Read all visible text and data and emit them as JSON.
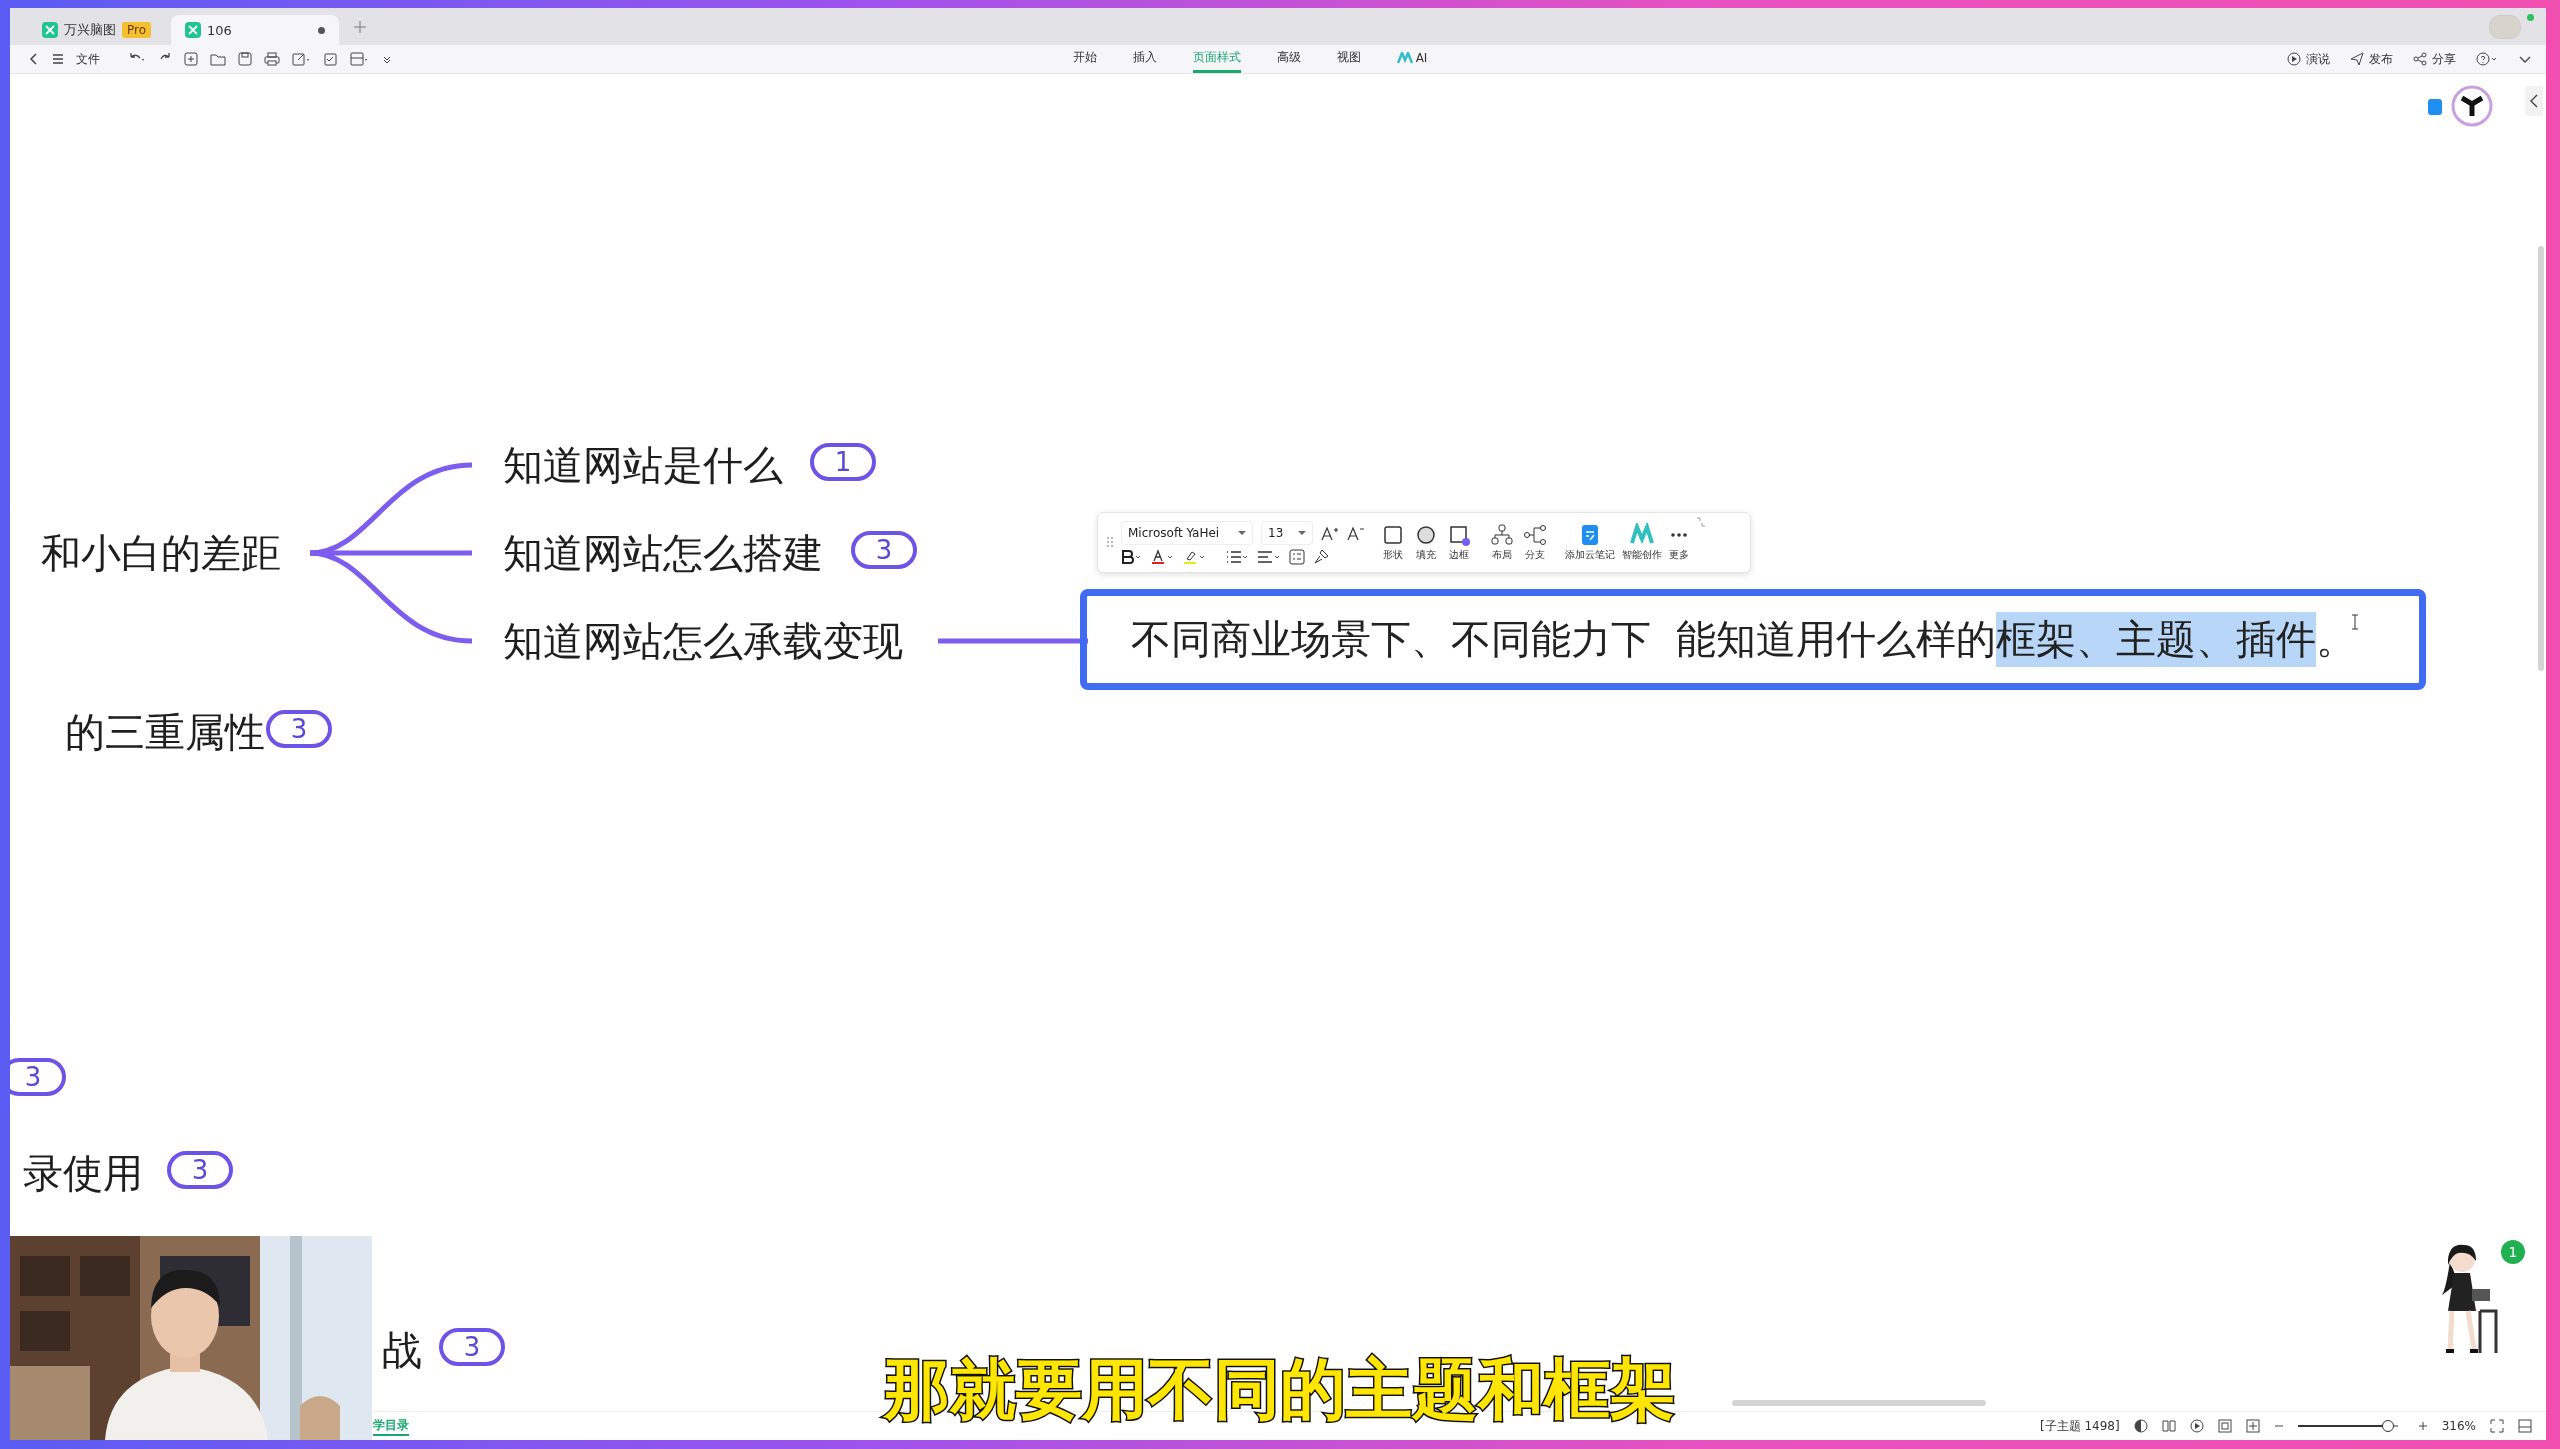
{
  "tabs": [
    {
      "label": "万兴脑图",
      "badge": "Pro",
      "selected": false
    },
    {
      "label": "106",
      "selected": true
    }
  ],
  "file_menu": "文件",
  "ribbon_tabs": [
    {
      "label": "开始",
      "selected": false
    },
    {
      "label": "插入",
      "selected": false
    },
    {
      "label": "页面样式",
      "selected": true
    },
    {
      "label": "高级",
      "selected": false
    },
    {
      "label": "视图",
      "selected": false
    },
    {
      "label": "AI",
      "selected": false
    }
  ],
  "actions": [
    {
      "kind": "present",
      "label": "演说"
    },
    {
      "kind": "publish",
      "label": "发布"
    },
    {
      "kind": "share",
      "label": "分享"
    }
  ],
  "mind_map": {
    "root": "和小白的差距",
    "branches": [
      {
        "text": "知道网站是什么",
        "count": "1"
      },
      {
        "text": "知道网站怎么搭建",
        "count": "3"
      },
      {
        "text": "知道网站怎么承载变现"
      }
    ],
    "note": {
      "segments": [
        {
          "text": "不同商业场景下、不同能力下  能知道用什么样的",
          "selected": false
        },
        {
          "text": "框架、主题、插件",
          "selected": true
        },
        {
          "text": "。",
          "selected": false
        }
      ]
    },
    "other_nodes": [
      {
        "text": "的三重属性",
        "count": "3"
      },
      {
        "count": "3"
      },
      {
        "text": "录使用",
        "count": "3"
      },
      {
        "text": "战",
        "count": "3"
      }
    ]
  },
  "format_toolbar": {
    "font": "Microsoft YaHei",
    "size": "13",
    "tools": [
      {
        "kind": "shape",
        "label": "形状"
      },
      {
        "kind": "fill",
        "label": "填充"
      },
      {
        "kind": "border",
        "label": "边框"
      },
      {
        "kind": "layout",
        "label": "布局"
      },
      {
        "kind": "branch",
        "label": "分支"
      },
      {
        "kind": "note",
        "label": "添加云笔记"
      },
      {
        "kind": "ai",
        "label": "智能创作"
      },
      {
        "kind": "more",
        "label": "更多"
      }
    ]
  },
  "status_bar": {
    "sheet_tab": "学目录",
    "topic_count": "[子主题 1498]",
    "zoom": {
      "level": 0.85,
      "reading": "316%"
    }
  },
  "assistant_badge": "1",
  "subtitle": "那就要用不同的主题和框架"
}
